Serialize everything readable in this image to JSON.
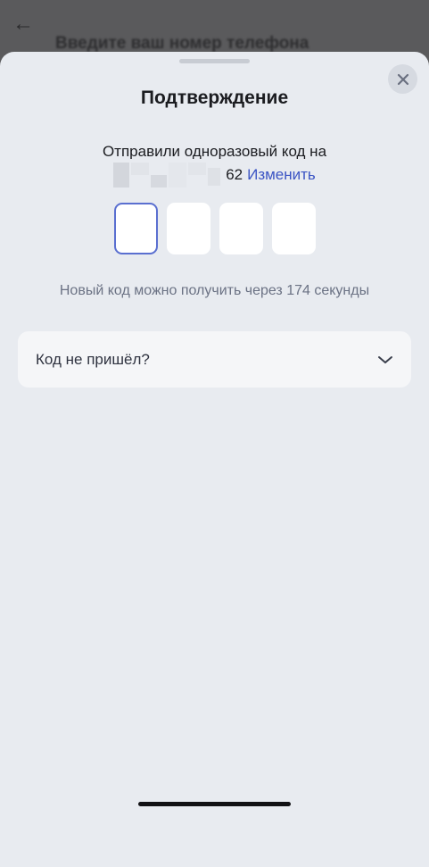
{
  "background": {
    "back_glyph": "←",
    "title": "Введите ваш номер телефона"
  },
  "sheet": {
    "title": "Подтверждение",
    "close_icon": "close-icon",
    "sent_line1": "Отправили одноразовый код на",
    "phone_suffix": "62",
    "change_label": "Изменить",
    "code_boxes": [
      "",
      "",
      "",
      ""
    ],
    "timer_text": "Новый код можно получить через 174 секунды",
    "accordion_label": "Код не пришёл?",
    "accordion_icon": "chevron-down-icon"
  },
  "colors": {
    "accent": "#3b54c4",
    "sheet_bg": "#e8ebf0",
    "active_border": "#5a6fd0"
  }
}
